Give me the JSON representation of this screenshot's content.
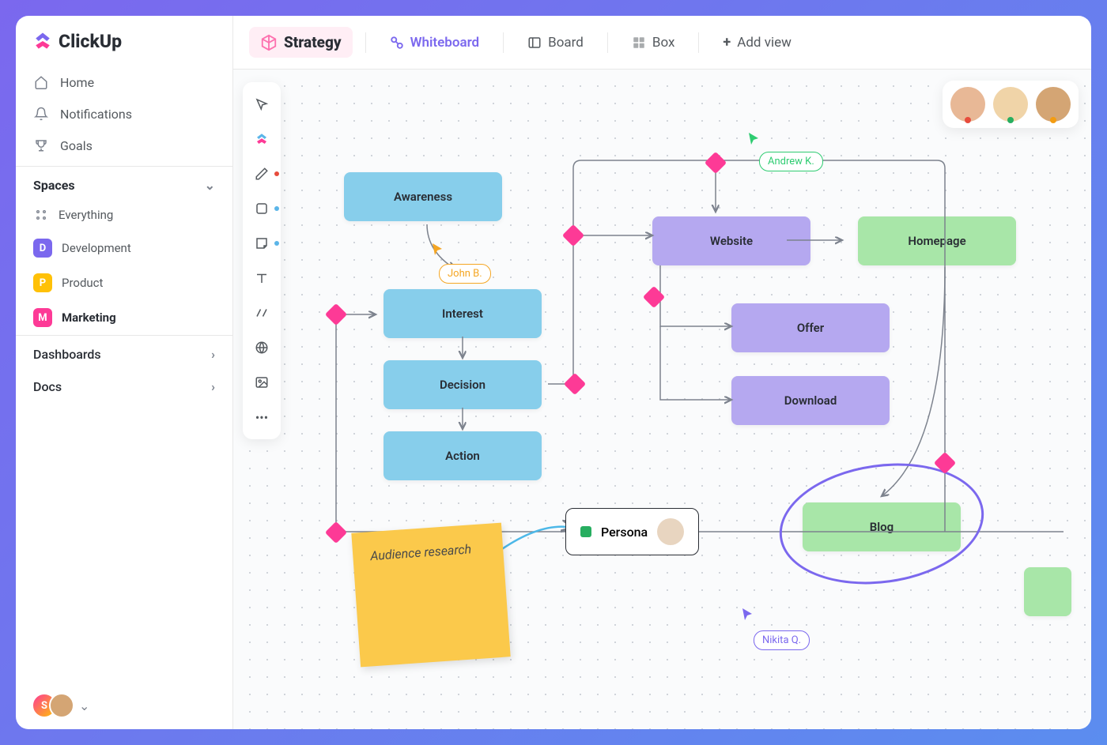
{
  "brand": "ClickUp",
  "nav": {
    "home": "Home",
    "notifications": "Notifications",
    "goals": "Goals"
  },
  "spaces": {
    "header": "Spaces",
    "everything": "Everything",
    "items": [
      {
        "letter": "D",
        "label": "Development",
        "color": "#7b68ee"
      },
      {
        "letter": "P",
        "label": "Product",
        "color": "#ffc107"
      },
      {
        "letter": "M",
        "label": "Marketing",
        "color": "#fd3a96"
      }
    ],
    "active_index": 2
  },
  "sections": {
    "dashboards": "Dashboards",
    "docs": "Docs"
  },
  "topbar": {
    "title": "Strategy",
    "views": {
      "whiteboard": "Whiteboard",
      "board": "Board",
      "box": "Box",
      "add": "Add view"
    }
  },
  "whiteboard": {
    "nodes": {
      "awareness": "Awareness",
      "interest": "Interest",
      "decision": "Decision",
      "action": "Action",
      "website": "Website",
      "offer": "Offer",
      "download": "Download",
      "homepage": "Homepage",
      "blog": "Blog",
      "persona": "Persona"
    },
    "sticky": "Audience research",
    "cursors": {
      "john": "John B.",
      "andrew": "Andrew K.",
      "nikita": "Nikita Q."
    }
  },
  "collaborators": [
    {
      "status_color": "#e74c3c"
    },
    {
      "status_color": "#27ae60"
    },
    {
      "status_color": "#f39c12"
    }
  ],
  "tool_dots": {
    "red": "#e74c3c",
    "blue": "#5bb5e8"
  }
}
